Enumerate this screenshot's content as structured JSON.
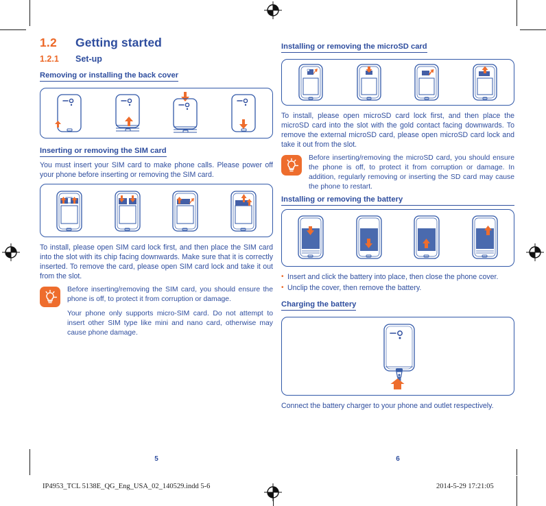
{
  "document": {
    "colors": {
      "accent_orange": "#EC6726",
      "heading_blue": "#2E4D9E",
      "line_blue": "#3158A8",
      "battery_fill": "#4A6AAE"
    }
  },
  "left_page": {
    "section_number": "1.2",
    "section_title": "Getting started",
    "subsection_number": "1.2.1",
    "subsection_title": "Set-up",
    "back_cover": {
      "heading": "Removing or installing the back cover",
      "figure_name": "back-cover-figure",
      "steps": [
        {
          "label": "lift-corner",
          "arrow": "up",
          "arrow_pos": "bottom-left"
        },
        {
          "label": "lift-cover",
          "arrow": "up",
          "arrow_pos": "bottom-center"
        },
        {
          "label": "place-cover",
          "arrow": "down",
          "arrow_pos": "top-center"
        },
        {
          "label": "press-cover",
          "arrow": "down",
          "arrow_pos": "bottom-center"
        }
      ]
    },
    "sim_card": {
      "heading": "Inserting or removing the SIM card",
      "intro": "You must insert your SIM card to make phone calls. Please power off your phone before inserting or removing the SIM card.",
      "figure_name": "sim-card-figure",
      "steps": [
        {
          "label": "open-lock",
          "arrows": "up-up"
        },
        {
          "label": "insert-card",
          "arrows": "down-down"
        },
        {
          "label": "close-lock",
          "arrows": "up-right"
        },
        {
          "label": "remove-card",
          "arrows": "up-up"
        }
      ],
      "body": "To install, please open SIM card lock first, and then place the SIM card into the slot with its chip facing downwards. Make sure that it is correctly inserted. To remove the card, please open SIM card lock and take it out from the slot.",
      "tips": [
        "Before inserting/removing the SIM card, you should ensure the phone is off, to protect it from corruption or damage.",
        "Your phone only supports micro-SIM card. Do not attempt to insert other SIM type like mini and nano card, otherwise may cause phone damage."
      ]
    },
    "page_number": "5"
  },
  "right_page": {
    "microsd": {
      "heading": "Installing or removing the microSD card",
      "figure_name": "microsd-figure",
      "steps": [
        {
          "label": "open-lock",
          "arrow": "up"
        },
        {
          "label": "insert-card",
          "arrow": "down"
        },
        {
          "label": "close-lock",
          "arrow": "up-right"
        },
        {
          "label": "remove-card",
          "arrow": "up"
        }
      ],
      "body": "To install, please open microSD card lock first, and then place the microSD card into the slot with the gold contact facing downwards. To remove the external microSD card, please open microSD card lock and take it out from the slot.",
      "tips": [
        "Before inserting/removing the microSD card, you should ensure the phone is off, to protect it from corruption or damage. In addition, regularly removing or inserting the SD card may cause the phone to restart."
      ]
    },
    "battery": {
      "heading": "Installing or removing the battery",
      "figure_name": "battery-figure",
      "steps": [
        {
          "label": "place-battery",
          "arrow": "down",
          "arrow_pos": "top"
        },
        {
          "label": "push-battery",
          "arrow": "down",
          "arrow_pos": "bottom"
        },
        {
          "label": "lift-battery",
          "arrow": "up",
          "arrow_pos": "bottom"
        },
        {
          "label": "remove-battery",
          "arrow": "up",
          "arrow_pos": "top"
        }
      ],
      "bullets": [
        "Insert and click the battery into place, then close the phone cover.",
        "Unclip the cover, then remove the battery."
      ]
    },
    "charging": {
      "heading": "Charging the battery",
      "figure_name": "charging-figure",
      "caption": "Connect the battery charger to your phone and outlet respectively."
    },
    "page_number": "6"
  },
  "footer": {
    "left": "IP4953_TCL 5138E_QG_Eng_USA_02_140529.indd   5-6",
    "right": "2014-5-29   17:21:05"
  }
}
